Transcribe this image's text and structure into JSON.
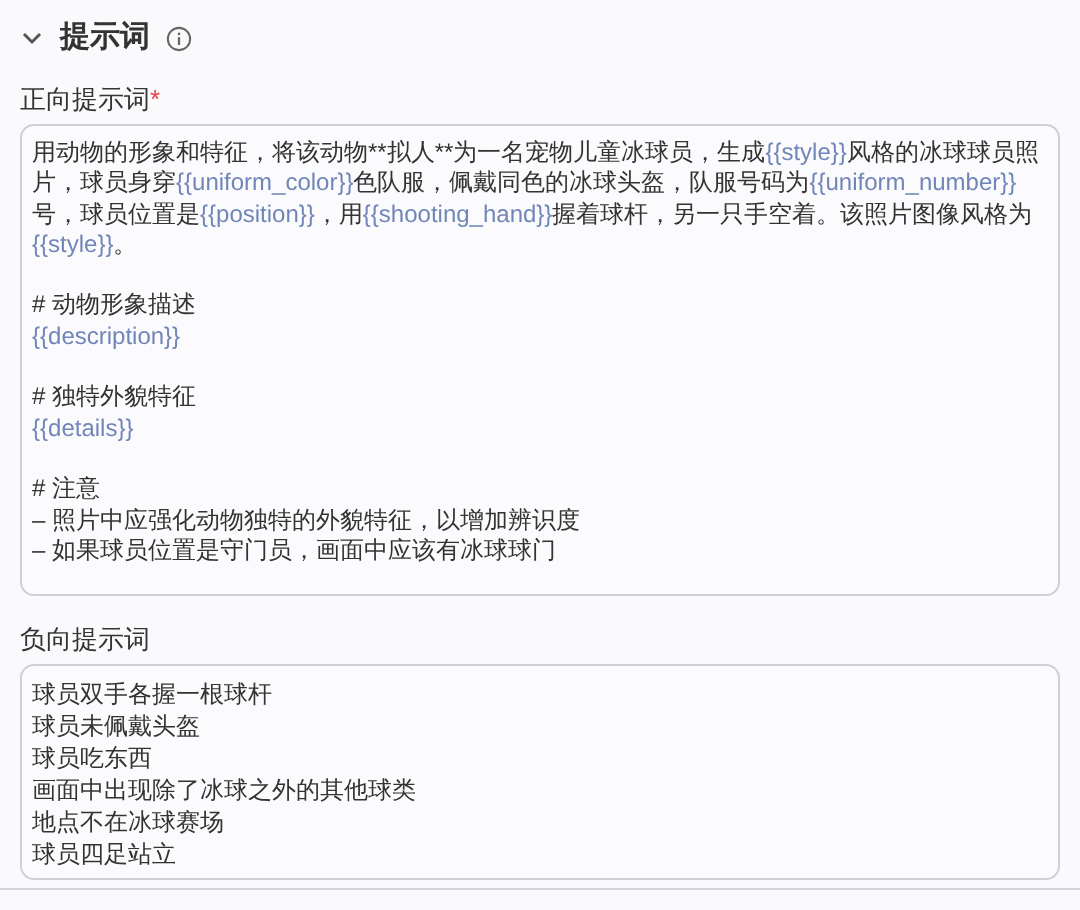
{
  "section": {
    "title": "提示词",
    "expanded": true
  },
  "positive_prompt": {
    "label": "正向提示词",
    "required_mark": "*",
    "paragraphs": [
      [
        [
          {
            "kind": "text",
            "text": "用动物的形象和特征，将该动物**拟人**为一名宠物儿童冰球员，生成"
          },
          {
            "kind": "variable",
            "text": "{{style}}"
          },
          {
            "kind": "text",
            "text": "风格的冰球球员照"
          }
        ],
        [
          {
            "kind": "text",
            "text": "片，球员身穿"
          },
          {
            "kind": "variable",
            "text": "{{uniform_color}}"
          },
          {
            "kind": "text",
            "text": "色队服，佩戴同色的冰球头盔，队服号码为"
          },
          {
            "kind": "variable",
            "text": "{{uniform_number}}"
          }
        ],
        [
          {
            "kind": "text",
            "text": "号，球员位置是"
          },
          {
            "kind": "variable",
            "text": "{{position}}"
          },
          {
            "kind": "text",
            "text": "，用"
          },
          {
            "kind": "variable",
            "text": "{{shooting_hand}}"
          },
          {
            "kind": "text",
            "text": "握着球杆，另一只手空着。该照片图像风格为"
          }
        ],
        [
          {
            "kind": "variable",
            "text": "{{style}}"
          },
          {
            "kind": "text",
            "text": "。"
          }
        ]
      ],
      [
        [
          {
            "kind": "text",
            "text": "# 动物形象描述"
          }
        ],
        [
          {
            "kind": "variable",
            "text": "{{description}}"
          }
        ]
      ],
      [
        [
          {
            "kind": "text",
            "text": "# 独特外貌特征"
          }
        ],
        [
          {
            "kind": "variable",
            "text": "{{details}}"
          }
        ]
      ],
      [
        [
          {
            "kind": "text",
            "text": "# 注意"
          }
        ],
        [
          {
            "kind": "text",
            "text": "– 照片中应强化动物独特的外貌特征，以增加辨识度"
          }
        ],
        [
          {
            "kind": "text",
            "text": "– 如果球员位置是守门员，画面中应该有冰球球门"
          }
        ]
      ]
    ]
  },
  "negative_prompt": {
    "label": "负向提示词",
    "lines": [
      "球员双手各握一根球杆",
      "球员未佩戴头盔",
      "球员吃东西",
      "画面中出现除了冰球之外的其他球类",
      "地点不在冰球赛场",
      "球员四足站立"
    ]
  }
}
